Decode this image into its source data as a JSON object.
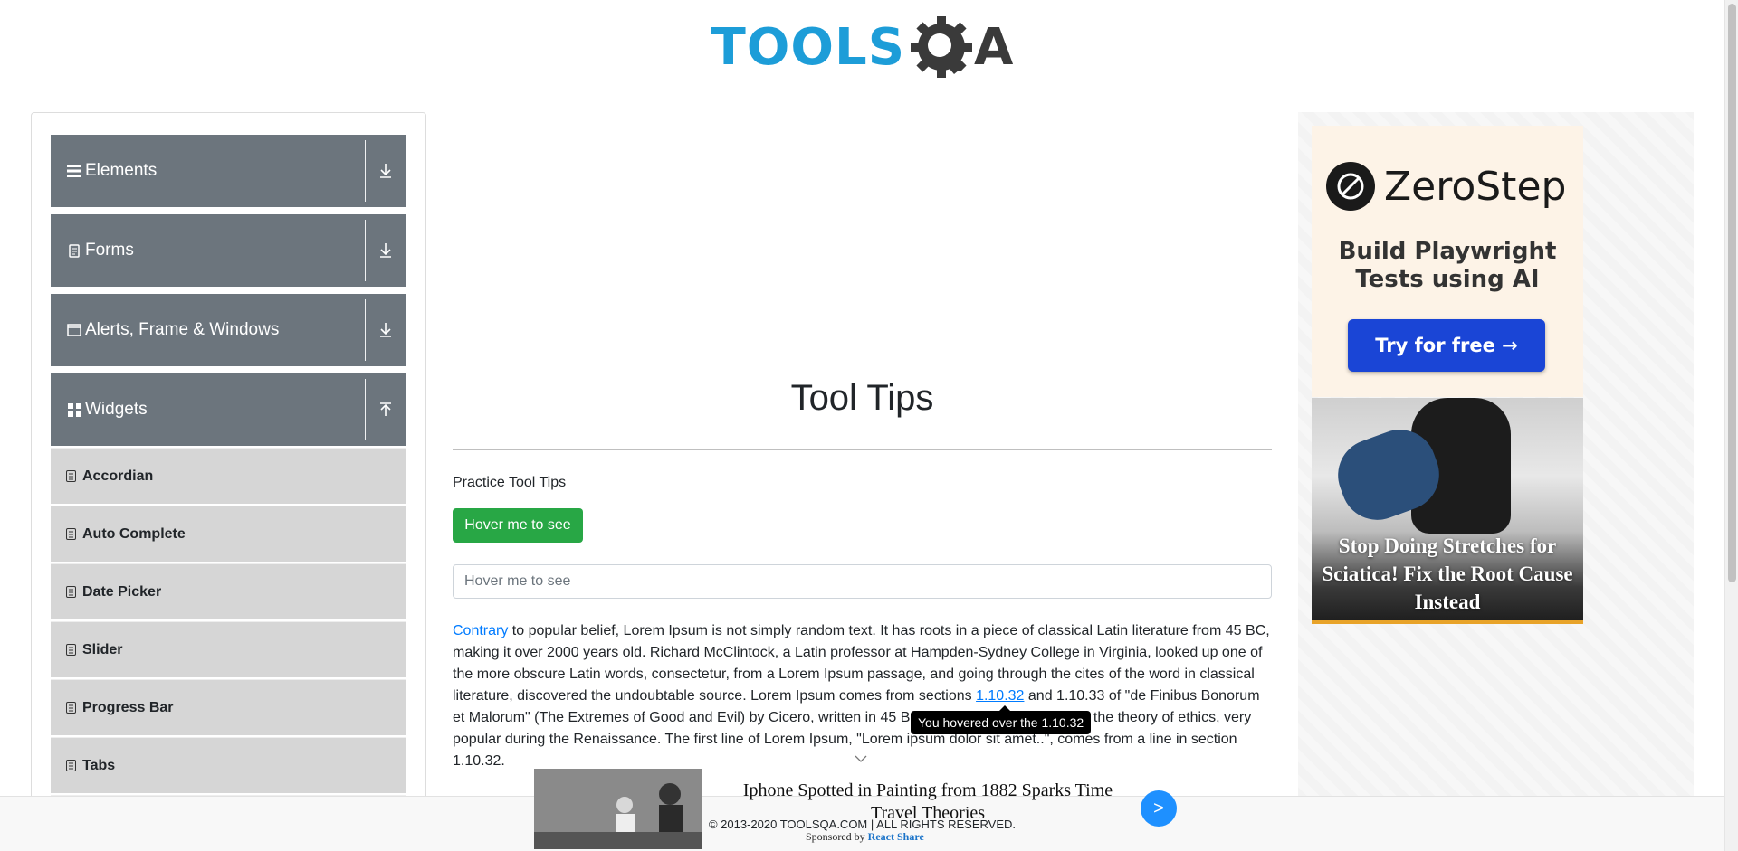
{
  "header": {
    "logo_tools": "TOOLS",
    "logo_qa": "A"
  },
  "sidebar": {
    "groups": [
      {
        "label": "Elements",
        "icon": "hamburger-icon",
        "arrow": "download-arrow-icon"
      },
      {
        "label": "Forms",
        "icon": "document-icon",
        "arrow": "download-arrow-icon"
      },
      {
        "label": "Alerts, Frame & Windows",
        "icon": "window-icon",
        "arrow": "download-arrow-icon"
      },
      {
        "label": "Widgets",
        "icon": "grid-icon",
        "arrow": "upload-arrow-icon"
      }
    ],
    "items": [
      {
        "label": "Accordian"
      },
      {
        "label": "Auto Complete"
      },
      {
        "label": "Date Picker"
      },
      {
        "label": "Slider"
      },
      {
        "label": "Progress Bar"
      },
      {
        "label": "Tabs"
      }
    ]
  },
  "main": {
    "title": "Tool Tips",
    "practice": "Practice Tool Tips",
    "button_label": "Hover me to see",
    "input_placeholder": "Hover me to see",
    "para_link": "Contrary",
    "para_part1": " to popular belief, Lorem Ipsum is not simply random text. It has roots in a piece of classical Latin literature from 45 BC, making it over 2000 years old. Richard McClintock, a Latin professor at Hampden-Sydney College in Virginia, looked up one of the more obscure Latin words, consectetur, from a Lorem Ipsum passage, and going through the cites of the word in classical literature, discovered the undoubtable source. Lorem Ipsum comes from sections ",
    "para_link2": "1.10.32",
    "para_part2": " and 1.10.33 of \"de Finibus Bonorum et Malorum\" (The Extremes of Good and Evil) by Cicero, written in 45 BC. This book is a treatise on the theory of ethics, very popular during the Renaissance. The first line of Lorem Ipsum, \"Lorem ipsum dolor sit amet..\", comes from a line in section 1.10.32.",
    "tooltip": "You hovered over the 1.10.32"
  },
  "right_ad": {
    "brand": "ZeroStep",
    "tagline": "Build Playwright Tests using AI",
    "cta": "Try for free →",
    "stretch_text": "Stop Doing Stretches for Sciatica! Fix the Root Cause Instead"
  },
  "footer": {
    "text": "© 2013-2020 TOOLSQA.COM | ALL RIGHTS RESERVED."
  },
  "bottom_ad": {
    "headline": "Iphone Spotted in Painting from 1882 Sparks Time Travel Theories",
    "sponsor_prefix": "Sponsored by ",
    "sponsor_name": "React Share",
    "next": ">"
  },
  "colors": {
    "accent": "#1d9dd8",
    "sidebar_header": "#6c757d",
    "sidebar_item": "#d6d6d6",
    "green": "#28a745",
    "link": "#007bff"
  }
}
